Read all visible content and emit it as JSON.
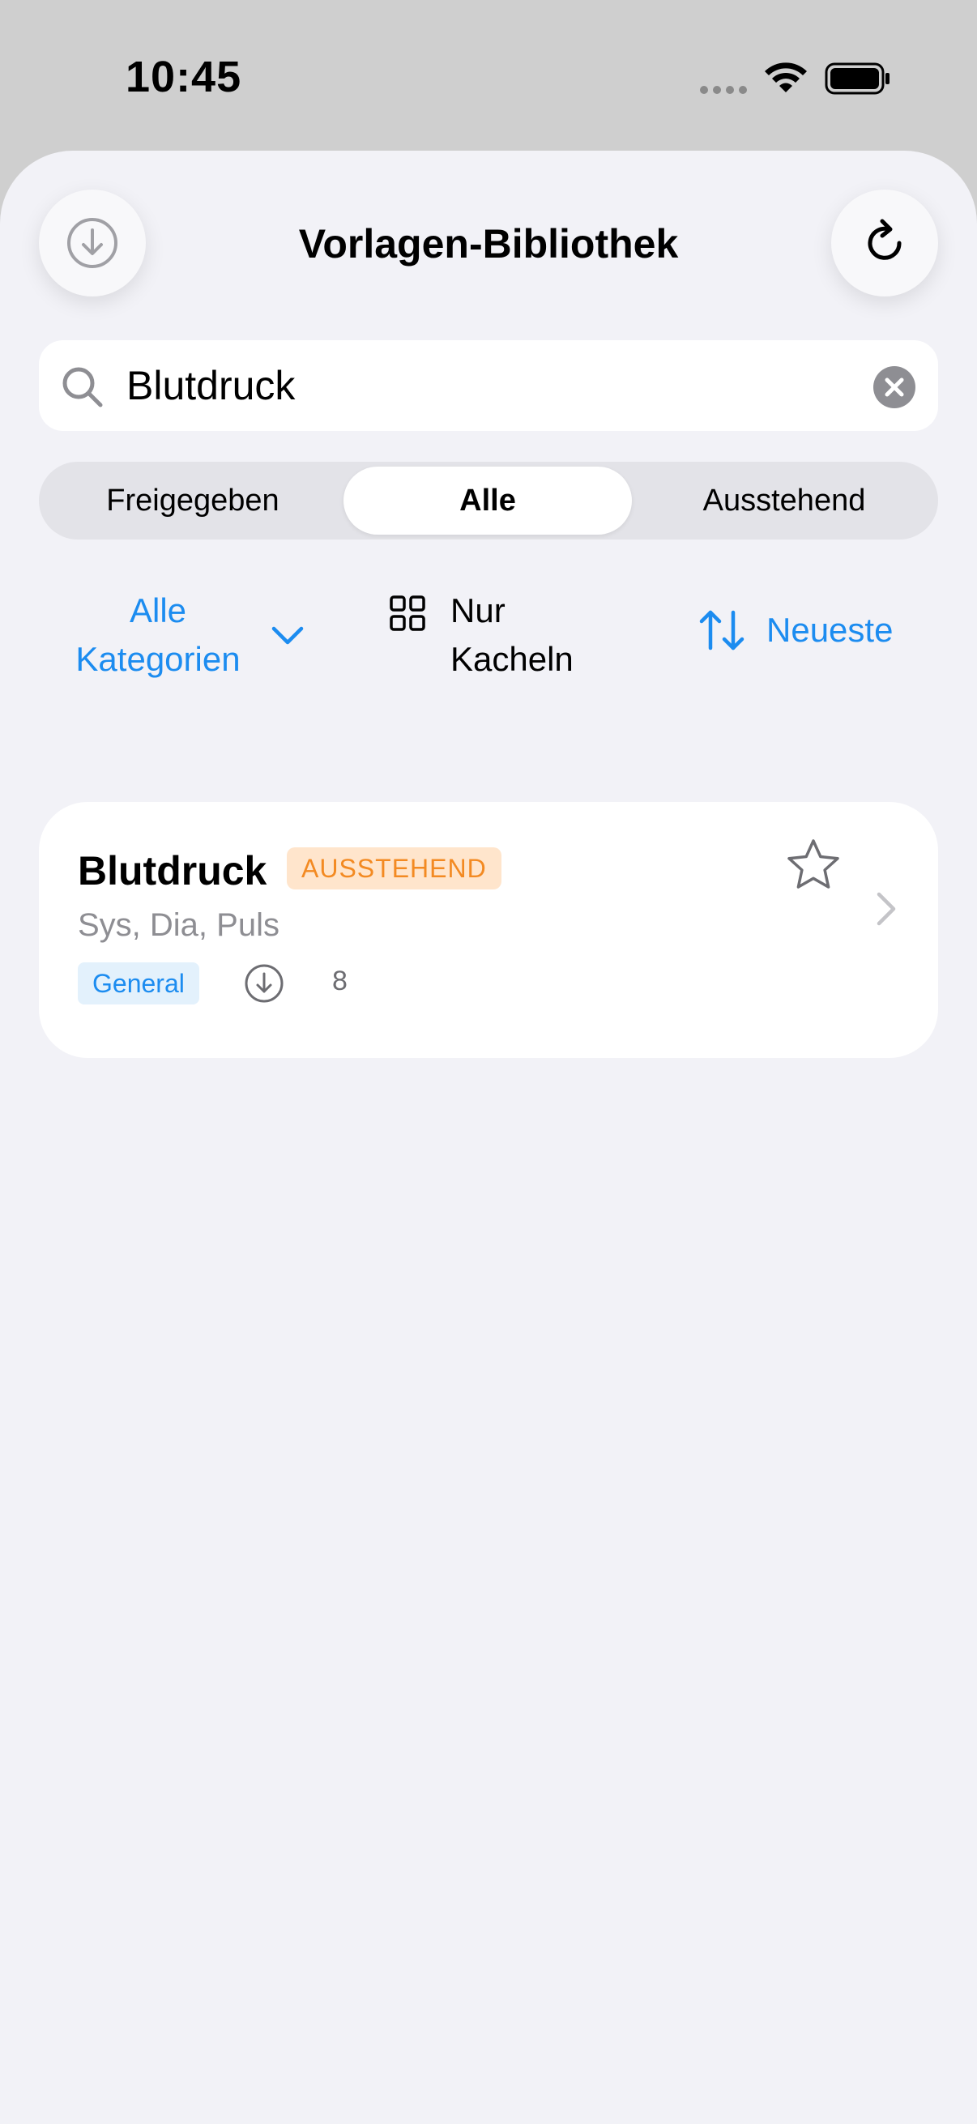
{
  "status_bar": {
    "time": "10:45"
  },
  "header": {
    "title": "Vorlagen-Bibliothek",
    "left_icon": "download-icon",
    "right_icon": "refresh-icon"
  },
  "search": {
    "value": "Blutdruck",
    "placeholder": ""
  },
  "segments": {
    "items": [
      "Freigegeben",
      "Alle",
      "Ausstehend"
    ],
    "selected": "Alle"
  },
  "filters": {
    "category_line1": "Alle",
    "category_line2": "Kategorien",
    "tiles_line1": "Nur",
    "tiles_line2": "Kacheln",
    "sort_label": "Neueste"
  },
  "results": [
    {
      "title": "Blutdruck",
      "status": "AUSSTEHEND",
      "subtitle": "Sys, Dia, Puls",
      "category": "General",
      "downloads": "8"
    }
  ],
  "colors": {
    "accent": "#1c8cf0",
    "pending_text": "#f38a22",
    "pending_bg": "#ffe5cc",
    "background": "#f2f2f7"
  }
}
